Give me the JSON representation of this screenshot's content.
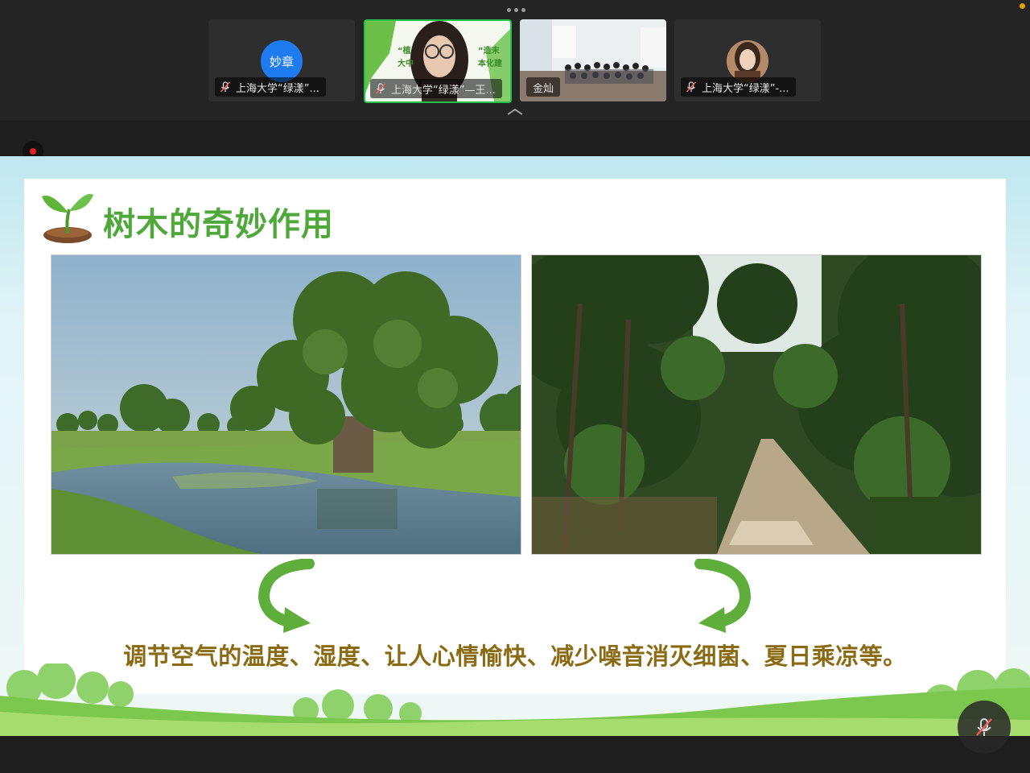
{
  "meeting": {
    "participants": [
      {
        "name": "上海大学“绿漾”...",
        "avatar_text": "妙章",
        "muted": true,
        "avatar_color": "#1e7cf0"
      },
      {
        "name": "上海大学“绿漾”—王...",
        "muted": true,
        "active_speaker": true,
        "overlay_text": [
          "“植",
          "”造末",
          "大中",
          "本化建"
        ]
      },
      {
        "name": "金灿",
        "muted": false
      },
      {
        "name": "上海大学“绿漾”-...",
        "muted": true
      }
    ],
    "icons": {
      "more": "more-dots-icon",
      "collapse": "chevron-up-icon",
      "record": "record-icon",
      "mic_off": "mic-off-icon"
    },
    "colors": {
      "active_border": "#23c249",
      "record": "#e02020"
    }
  },
  "slide": {
    "title": "树木的奇妙作用",
    "caption": "调节空气的温度、湿度、让人心情愉快、减少噪音消灭细菌、夏日乘凉等。",
    "colors": {
      "title": "#4ea83a",
      "caption": "#8a6a12",
      "arrow": "#5fae3c"
    },
    "images": [
      "large-tree-by-lake",
      "tree-lined-path"
    ]
  }
}
